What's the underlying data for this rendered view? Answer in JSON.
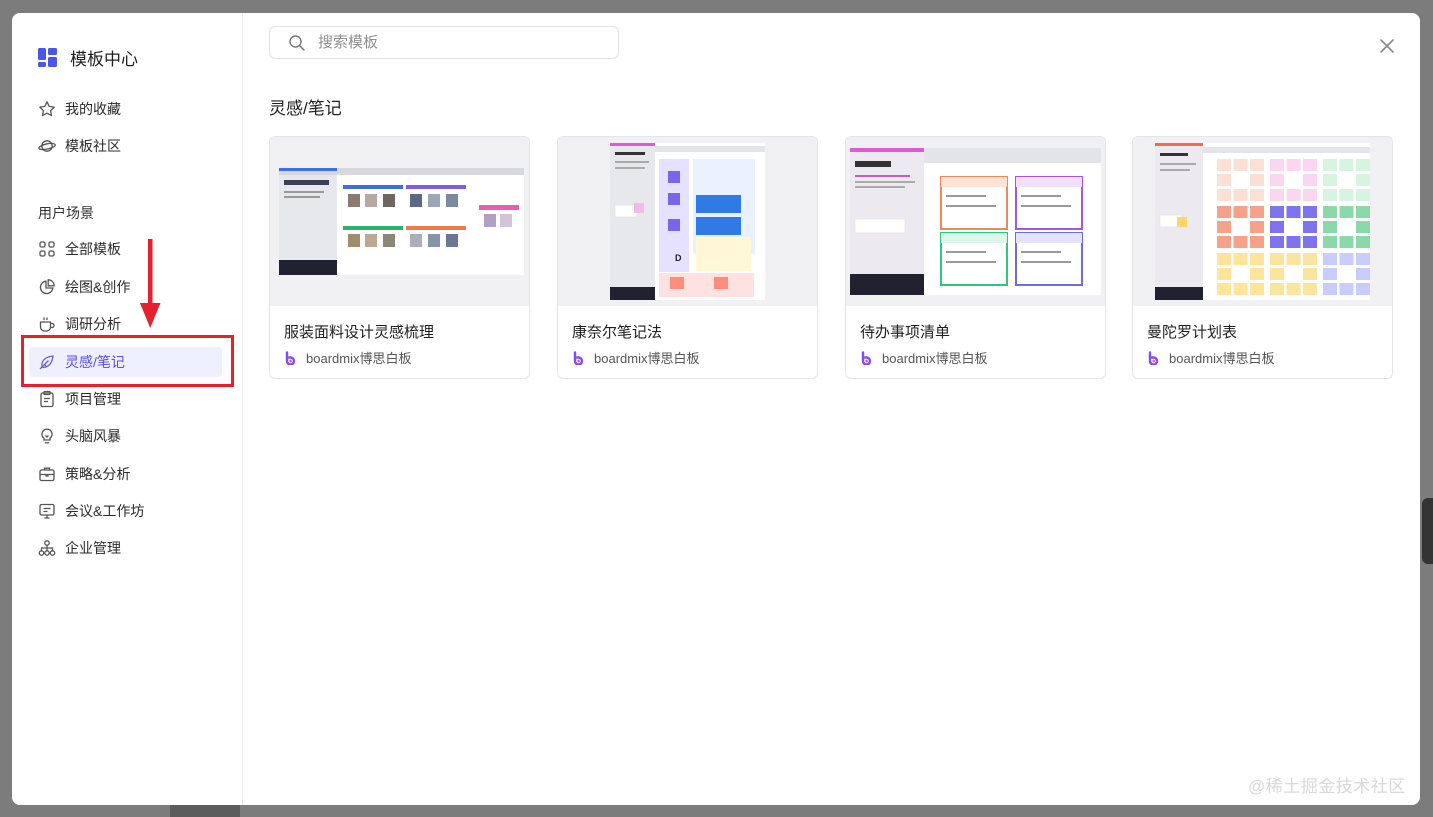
{
  "app": {
    "title": "模板中心"
  },
  "sidebar": {
    "top_items": [
      {
        "label": "我的收藏",
        "icon": "star-icon"
      },
      {
        "label": "模板社区",
        "icon": "planet-icon"
      }
    ],
    "group_title": "用户场景",
    "scene_items": [
      {
        "label": "全部模板",
        "icon": "grid-icon"
      },
      {
        "label": "绘图&创作",
        "icon": "pie-chart-icon"
      },
      {
        "label": "调研分析",
        "icon": "coffee-cup-icon"
      },
      {
        "label": "灵感/笔记",
        "icon": "leaf-icon",
        "active": true
      },
      {
        "label": "项目管理",
        "icon": "clipboard-icon"
      },
      {
        "label": "头脑风暴",
        "icon": "lightbulb-icon"
      },
      {
        "label": "策略&分析",
        "icon": "briefcase-icon"
      },
      {
        "label": "会议&工作坊",
        "icon": "presentation-icon"
      },
      {
        "label": "企业管理",
        "icon": "org-chart-icon"
      }
    ]
  },
  "search": {
    "placeholder": "搜索模板",
    "value": ""
  },
  "main": {
    "section_title": "灵感/笔记",
    "cards": [
      {
        "title": "服装面料设计灵感梳理",
        "author": "boardmix博思白板"
      },
      {
        "title": "康奈尔笔记法",
        "author": "boardmix博思白板"
      },
      {
        "title": "待办事项清单",
        "author": "boardmix博思白板"
      },
      {
        "title": "曼陀罗计划表",
        "author": "boardmix博思白板"
      }
    ]
  },
  "watermark": "@稀土掘金技术社区",
  "colors": {
    "accent": "#5a4fdf",
    "active_bg": "#eeefff",
    "annotation_red": "#e5212d"
  }
}
